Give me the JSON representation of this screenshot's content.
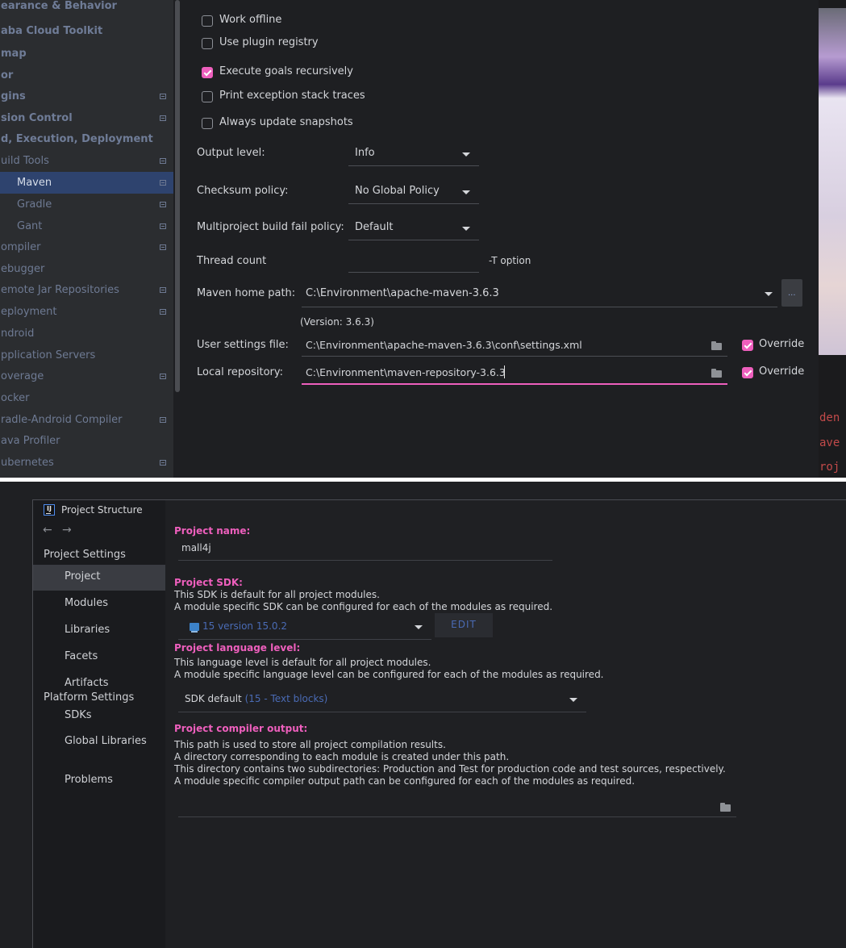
{
  "maven_settings": {
    "tree": [
      {
        "label": "earance & Behavior",
        "style": "bold"
      },
      {
        "label": "aba Cloud Toolkit",
        "style": "bold"
      },
      {
        "label": "map",
        "style": "bold"
      },
      {
        "label": "or",
        "style": "bold"
      },
      {
        "label": "gins",
        "style": "bold",
        "has_page_icon": true
      },
      {
        "label": "sion Control",
        "style": "bold",
        "has_page_icon": true
      },
      {
        "label": "d, Execution, Deployment",
        "style": "bold"
      },
      {
        "label": "uild Tools",
        "has_page_icon": true
      },
      {
        "label": "Maven",
        "selected": true,
        "has_page_icon": true
      },
      {
        "label": "Gradle",
        "has_page_icon": true
      },
      {
        "label": "Gant",
        "has_page_icon": true
      },
      {
        "label": "ompiler",
        "has_page_icon": true
      },
      {
        "label": "ebugger"
      },
      {
        "label": "emote Jar Repositories",
        "has_page_icon": true
      },
      {
        "label": "eployment",
        "has_page_icon": true
      },
      {
        "label": "ndroid"
      },
      {
        "label": "pplication Servers"
      },
      {
        "label": "overage",
        "has_page_icon": true
      },
      {
        "label": "ocker"
      },
      {
        "label": "radle-Android Compiler",
        "has_page_icon": true
      },
      {
        "label": "ava Profiler"
      },
      {
        "label": "ubernetes",
        "has_page_icon": true
      }
    ],
    "checkboxes": {
      "work_offline": {
        "label": "Work offline",
        "checked": false
      },
      "use_plugin_registry": {
        "label": "Use plugin registry",
        "checked": false
      },
      "execute_goals_recursively": {
        "label": "Execute goals recursively",
        "checked": true
      },
      "print_exception_stack_traces": {
        "label": "Print exception stack traces",
        "checked": false
      },
      "always_update_snapshots": {
        "label": "Always update snapshots",
        "checked": false
      }
    },
    "output_level": {
      "label": "Output level:",
      "value": "Info"
    },
    "checksum_policy": {
      "label": "Checksum policy:",
      "value": "No Global Policy"
    },
    "multiproject_fail_policy": {
      "label": "Multiproject build fail policy:",
      "value": "Default"
    },
    "thread_count": {
      "label": "Thread count",
      "value": "",
      "suffix": "-T option"
    },
    "maven_home": {
      "label": "Maven home path:",
      "value": "C:\\Environment\\apache-maven-3.6.3",
      "browse_label": "...",
      "version": "(Version: 3.6.3)"
    },
    "user_settings": {
      "label": "User settings file:",
      "value": "C:\\Environment\\apache-maven-3.6.3\\conf\\settings.xml",
      "override_label": "Override",
      "override": true
    },
    "local_repository": {
      "label": "Local repository:",
      "value": "C:\\Environment\\maven-repository-3.6.3",
      "override_label": "Override",
      "override": true
    },
    "background_code": [
      "den",
      "ave",
      "roj"
    ]
  },
  "project_structure": {
    "window_title": "Project Structure",
    "nav": {
      "back": "←",
      "forward": "→"
    },
    "sidebar": {
      "project_settings_header": "Project Settings",
      "project_items": [
        "Project",
        "Modules",
        "Libraries",
        "Facets",
        "Artifacts"
      ],
      "platform_settings_header": "Platform Settings",
      "platform_items": [
        "SDKs",
        "Global Libraries"
      ],
      "problems": "Problems",
      "selected": "Project"
    },
    "project_name": {
      "title": "Project name:",
      "value": "mall4j"
    },
    "project_sdk": {
      "title": "Project SDK:",
      "desc": [
        "This SDK is default for all project modules.",
        "A module specific SDK can be configured for each of the modules as required."
      ],
      "value": "15 version 15.0.2",
      "edit_label": "EDIT"
    },
    "language_level": {
      "title": "Project language level:",
      "desc": [
        "This language level is default for all project modules.",
        "A module specific language level can be configured for each of the modules as required."
      ],
      "value": "SDK default",
      "value_detail": "(15 - Text blocks)"
    },
    "compiler_output": {
      "title": "Project compiler output:",
      "desc": [
        "This path is used to store all project compilation results.",
        "A directory corresponding to each module is created under this path.",
        "This directory contains two subdirectories: Production and Test for production code and test sources, respectively.",
        "A module specific compiler output path can be configured for each of the modules as required."
      ],
      "value": ""
    }
  }
}
